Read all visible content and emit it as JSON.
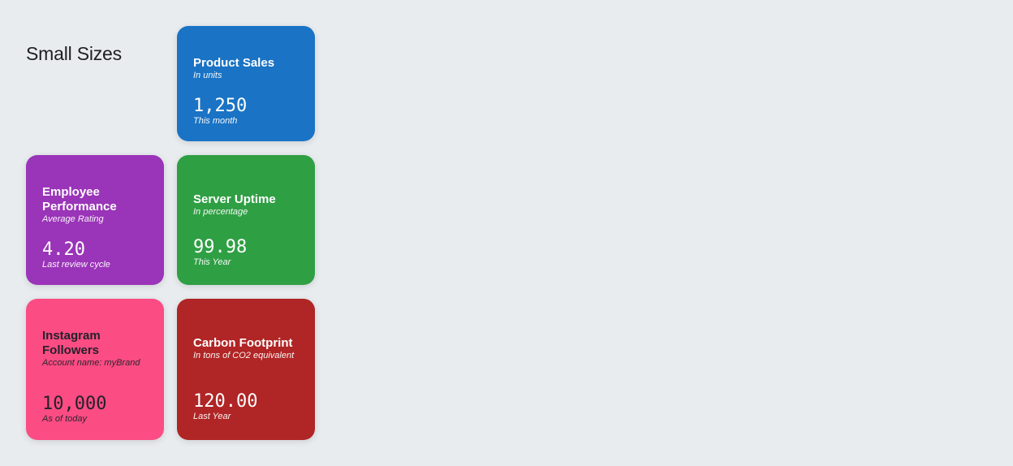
{
  "section": {
    "title": "Small Sizes"
  },
  "cards": {
    "sales": {
      "title": "Product Sales",
      "subtitle": "In units",
      "value": "1,250",
      "caption": "This month",
      "color": "#1a73c4"
    },
    "employee": {
      "title": "Employee Performance",
      "subtitle": "Average Rating",
      "value": "4.20",
      "caption": "Last review cycle",
      "color": "#9a34b8"
    },
    "server": {
      "title": "Server Uptime",
      "subtitle": "In percentage",
      "value": "99.98",
      "caption": "This Year",
      "color": "#2f9f44"
    },
    "instagram": {
      "title": "Instagram Followers",
      "subtitle": "Account name: myBrand",
      "value": "10,000",
      "caption": "As of today",
      "color": "#fc4c84"
    },
    "carbon": {
      "title": "Carbon Footprint",
      "subtitle": "In tons of CO2 equivalent",
      "value": "120.00",
      "caption": "Last Year",
      "color": "#b02525"
    }
  }
}
